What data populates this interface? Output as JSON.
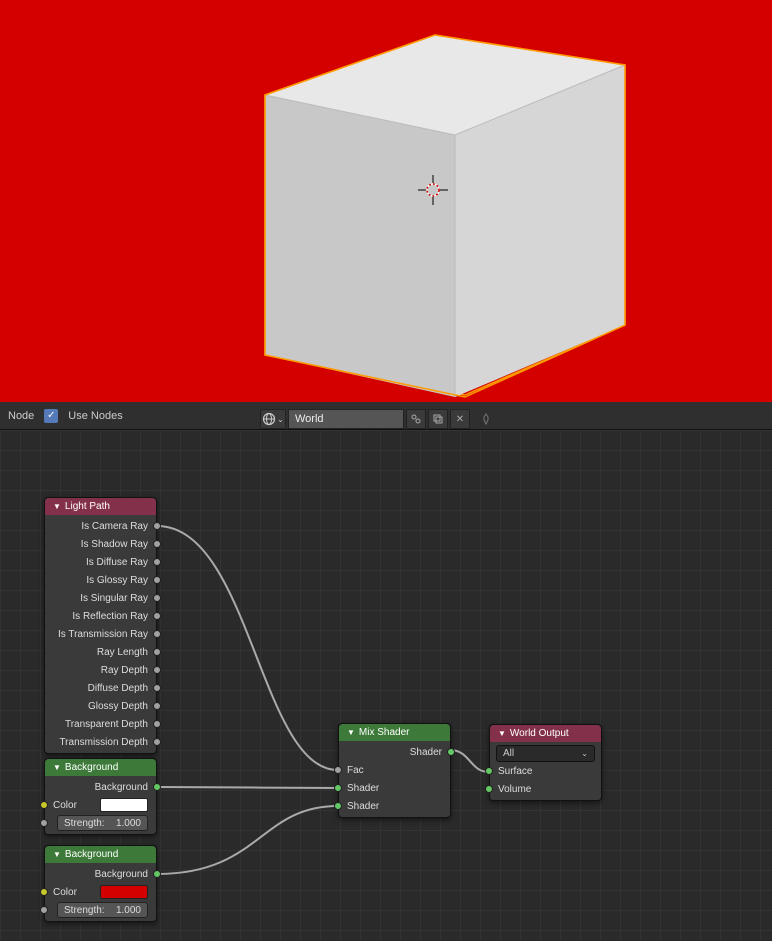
{
  "viewport": {
    "background_color": "#d40000"
  },
  "header": {
    "mode": "Node",
    "use_nodes_checked": true,
    "use_nodes_label": "Use Nodes",
    "world_name": "World"
  },
  "nodes": {
    "light_path": {
      "title": "Light Path",
      "outputs": [
        "Is Camera Ray",
        "Is Shadow Ray",
        "Is Diffuse Ray",
        "Is Glossy Ray",
        "Is Singular Ray",
        "Is Reflection Ray",
        "Is Transmission Ray",
        "Ray Length",
        "Ray Depth",
        "Diffuse Depth",
        "Glossy Depth",
        "Transparent Depth",
        "Transmission Depth"
      ]
    },
    "background1": {
      "title": "Background",
      "output": "Background",
      "color_label": "Color",
      "color_value": "#ffffff",
      "strength_label": "Strength:",
      "strength_value": "1.000"
    },
    "background2": {
      "title": "Background",
      "output": "Background",
      "color_label": "Color",
      "color_value": "#d40000",
      "strength_label": "Strength:",
      "strength_value": "1.000"
    },
    "mix_shader": {
      "title": "Mix Shader",
      "output": "Shader",
      "inputs": [
        "Fac",
        "Shader",
        "Shader"
      ]
    },
    "world_output": {
      "title": "World Output",
      "target": "All",
      "inputs": [
        "Surface",
        "Volume"
      ]
    }
  }
}
